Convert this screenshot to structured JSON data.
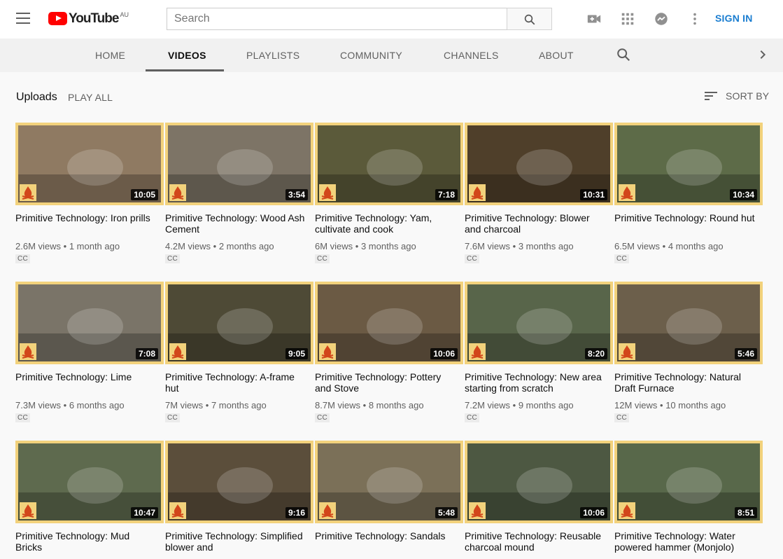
{
  "masthead": {
    "logo_text": "YouTube",
    "logo_country": "AU",
    "search_placeholder": "Search",
    "signin_label": "SIGN IN",
    "icons": [
      "menu-icon",
      "search-icon",
      "video-camera-icon",
      "apps-grid-icon",
      "messages-icon",
      "more-vert-icon"
    ],
    "brand_color": "#ff0000",
    "signin_color": "#1a7dd0"
  },
  "tabs": {
    "items": [
      {
        "label": "HOME"
      },
      {
        "label": "VIDEOS",
        "active": true
      },
      {
        "label": "PLAYLISTS"
      },
      {
        "label": "COMMUNITY"
      },
      {
        "label": "CHANNELS"
      },
      {
        "label": "ABOUT"
      }
    ]
  },
  "shelf": {
    "title": "Uploads",
    "play_all": "PLAY ALL",
    "sort_label": "SORT BY"
  },
  "videos": [
    {
      "title": "Primitive Technology: Iron prills",
      "views": "2.6M views",
      "age": "1 month ago",
      "duration": "10:05",
      "badge": "CC"
    },
    {
      "title": "Primitive Technology: Wood Ash Cement",
      "views": "4.2M views",
      "age": "2 months ago",
      "duration": "3:54",
      "badge": "CC"
    },
    {
      "title": "Primitive Technology: Yam, cultivate and cook",
      "views": "6M views",
      "age": "3 months ago",
      "duration": "7:18",
      "badge": "CC"
    },
    {
      "title": "Primitive Technology: Blower and charcoal",
      "views": "7.6M views",
      "age": "3 months ago",
      "duration": "10:31",
      "badge": "CC"
    },
    {
      "title": "Primitive Technology: Round hut",
      "views": "6.5M views",
      "age": "4 months ago",
      "duration": "10:34",
      "badge": "CC"
    },
    {
      "title": "Primitive Technology: Lime",
      "views": "7.3M views",
      "age": "6 months ago",
      "duration": "7:08",
      "badge": "CC"
    },
    {
      "title": "Primitive Technology: A-frame hut",
      "views": "7M views",
      "age": "7 months ago",
      "duration": "9:05",
      "badge": "CC"
    },
    {
      "title": "Primitive Technology: Pottery and Stove",
      "views": "8.7M views",
      "age": "8 months ago",
      "duration": "10:06",
      "badge": "CC"
    },
    {
      "title": "Primitive Technology: New area starting from scratch",
      "views": "7.2M views",
      "age": "9 months ago",
      "duration": "8:20",
      "badge": "CC"
    },
    {
      "title": "Primitive Technology: Natural Draft Furnace",
      "views": "12M views",
      "age": "10 months ago",
      "duration": "5:46",
      "badge": "CC"
    },
    {
      "title": "Primitive Technology: Mud Bricks",
      "views": "",
      "age": "",
      "duration": "10:47",
      "badge": ""
    },
    {
      "title": "Primitive Technology: Simplified blower and",
      "views": "",
      "age": "",
      "duration": "9:16",
      "badge": ""
    },
    {
      "title": "Primitive Technology: Sandals",
      "views": "",
      "age": "",
      "duration": "5:48",
      "badge": ""
    },
    {
      "title": "Primitive Technology: Reusable charcoal mound",
      "views": "",
      "age": "",
      "duration": "10:06",
      "badge": ""
    },
    {
      "title": "Primitive Technology: Water powered hammer (Monjolo)",
      "views": "",
      "age": "",
      "duration": "8:51",
      "badge": ""
    }
  ],
  "thumb_palette": [
    "#8f7a62",
    "#7d7466",
    "#5b5a3a",
    "#4f3f2a",
    "#5d6b48",
    "#7a7468",
    "#4e4a36",
    "#6b5a44",
    "#58654a",
    "#6c5f4b",
    "#5e6a4e",
    "#5b4e3b",
    "#7b7058",
    "#4d5842",
    "#58684a"
  ],
  "accent_border": "#f2d27c"
}
